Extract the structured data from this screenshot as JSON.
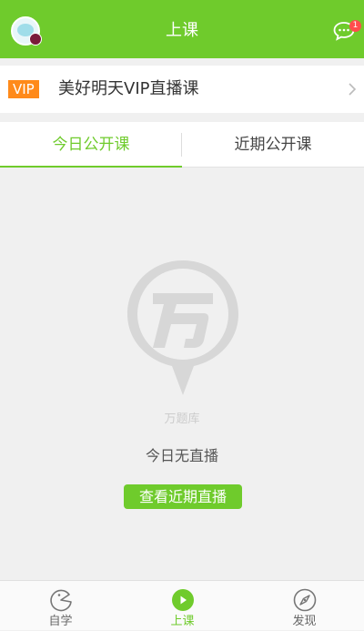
{
  "colors": {
    "accent": "#6fcb2c",
    "vip_tag": "#ff8a1a",
    "badge": "#ff4d4d"
  },
  "header": {
    "title": "上课",
    "avatar_icon": "avatar-icon",
    "message_icon": "chat-bubble-icon",
    "message_badge": "1"
  },
  "vip": {
    "tag": "VIP",
    "label": "美好明天VIP直播课",
    "icon": "chevron-right-icon"
  },
  "tabs": [
    {
      "label": "今日公开课",
      "active": true
    },
    {
      "label": "近期公开课",
      "active": false
    }
  ],
  "empty_state": {
    "logo_icon": "wantiku-pin-logo-icon",
    "brand": "万题库",
    "message": "今日无直播",
    "button_label": "查看近期直播"
  },
  "bottom_nav": [
    {
      "label": "自学",
      "icon": "pacman-icon",
      "active": false
    },
    {
      "label": "上课",
      "icon": "play-circle-icon",
      "active": true
    },
    {
      "label": "发现",
      "icon": "compass-icon",
      "active": false
    }
  ]
}
